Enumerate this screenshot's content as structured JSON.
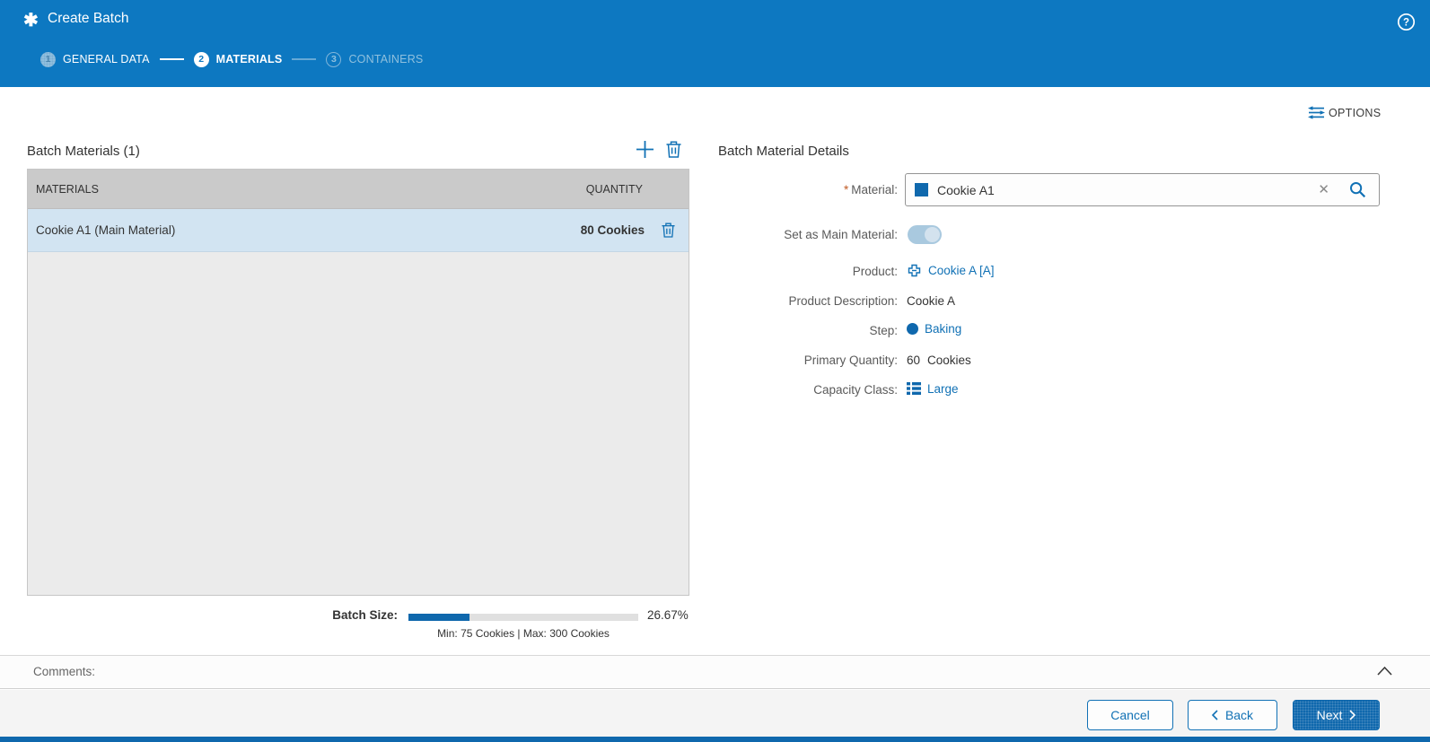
{
  "header": {
    "title": "Create Batch",
    "steps": [
      {
        "number": "1",
        "label": "GENERAL DATA",
        "state": "completed"
      },
      {
        "number": "2",
        "label": "MATERIALS",
        "state": "active"
      },
      {
        "number": "3",
        "label": "CONTAINERS",
        "state": "upcoming"
      }
    ]
  },
  "toolbar": {
    "options_label": "OPTIONS"
  },
  "materials_panel": {
    "title": "Batch Materials (1)",
    "columns": [
      "MATERIALS",
      "QUANTITY"
    ],
    "rows": [
      {
        "material": "Cookie A1 (Main Material)",
        "quantity": "80 Cookies",
        "selected": true
      }
    ],
    "batch_size": {
      "label": "Batch Size:",
      "percent": "26.67%",
      "percent_value": 26.67,
      "range": "Min: 75 Cookies | Max: 300 Cookies"
    }
  },
  "details_panel": {
    "title": "Batch Material Details",
    "fields": {
      "material": {
        "required_mark": "*",
        "label": "Material:",
        "value": "Cookie A1"
      },
      "main_material": {
        "label": "Set as Main Material:",
        "state": "on"
      },
      "product": {
        "label": "Product:",
        "value": "Cookie A [A]"
      },
      "product_description": {
        "label": "Product Description:",
        "value": "Cookie A"
      },
      "step": {
        "label": "Step:",
        "value": "Baking"
      },
      "primary_quantity": {
        "label": "Primary Quantity:",
        "value": "60",
        "uom": "Cookies"
      },
      "capacity_class": {
        "label": "Capacity Class:",
        "value": "Large"
      }
    }
  },
  "comments": {
    "label": "Comments:"
  },
  "footer": {
    "cancel_label": "Cancel",
    "back_label": "Back",
    "next_label": "Next"
  },
  "icons": {
    "app": "asterisk-icon",
    "help": "help-icon",
    "options": "options-sliders-icon",
    "add": "plus-icon",
    "delete": "trash-icon",
    "clear": "close-icon",
    "search": "search-icon",
    "product": "product-structure-icon",
    "step": "step-circle-icon",
    "capacity_class": "list-icon",
    "comments_collapse": "chevron-up-icon",
    "back": "chevron-left-icon",
    "next": "chevron-right-icon"
  },
  "colors": {
    "header_blue": "#0d78c1",
    "accent_blue": "#1171b5",
    "primary_button_blue": "#0f68ad",
    "selected_row_blue": "#d2e4f2",
    "table_header_gray": "#cacaca",
    "required_orange": "#c05b25"
  }
}
